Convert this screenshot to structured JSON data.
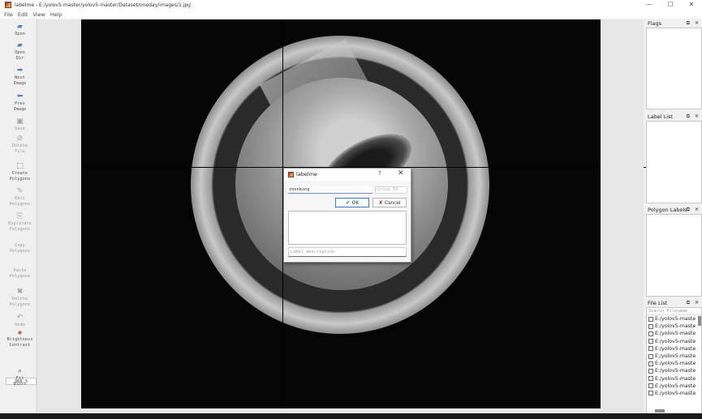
{
  "window": {
    "title": "labelme - E:/yolov5-master/yolov5-master/Dataset/oneday/images/1.jpg",
    "minimize": "—",
    "maximize": "☐",
    "close": "✕"
  },
  "menu": [
    "File",
    "Edit",
    "View",
    "Help"
  ],
  "toolbar": {
    "open": "Open",
    "open_dir": "Open\nDir",
    "next_image": "Next\nImage",
    "prev_image": "Prev\nImage",
    "save": "Save",
    "delete_file": "Delete\nFile",
    "create_polygons": "Create\nPolygons",
    "edit_polygons": "Edit\nPolygons",
    "duplicate_polygons": "Duplicate\nPolygons",
    "copy_polygons": "Copy\nPolygons",
    "paste_polygons": "Paste\nPolygons",
    "delete_polygons": "Delete\nPolygons",
    "undo": "Undo",
    "brightness_contrast": "Brightness\nContrast",
    "zoom": "366 %",
    "fit_width": "Fit\nWidth"
  },
  "dialog": {
    "title": "labelme",
    "help": "?",
    "close": "✕",
    "label_value": "zhenkong",
    "group_id_placeholder": "Group ID",
    "ok": "OK",
    "cancel": "Cancel",
    "description_placeholder": "Label description"
  },
  "docks": {
    "flags": "Flags",
    "label_list": "Label List",
    "polygon_labels": "Polygon Labels",
    "file_list": "File List",
    "float_close": "⧉ ✕",
    "search_placeholder": "Search Filename",
    "files": [
      "E:/yolov5-maste",
      "E:/yolov5-maste",
      "E:/yolov5-maste",
      "E:/yolov5-maste",
      "E:/yolov5-maste",
      "E:/yolov5-maste",
      "E:/yolov5-maste",
      "E:/yolov5-maste",
      "E:/yolov5-maste",
      "E:/yolov5-maste",
      "E:/yolov5-maste"
    ]
  },
  "icons": {
    "open": "folder-open-icon",
    "next": "arrow-right-icon",
    "prev": "arrow-left-icon",
    "save": "save-icon",
    "delete": "delete-icon",
    "create": "polygon-icon",
    "undo": "undo-icon",
    "brightness": "brightness-icon",
    "fit": "zoom-icon"
  },
  "colors": {
    "accent": "#3b78c9",
    "point": "#2e8b2e"
  }
}
